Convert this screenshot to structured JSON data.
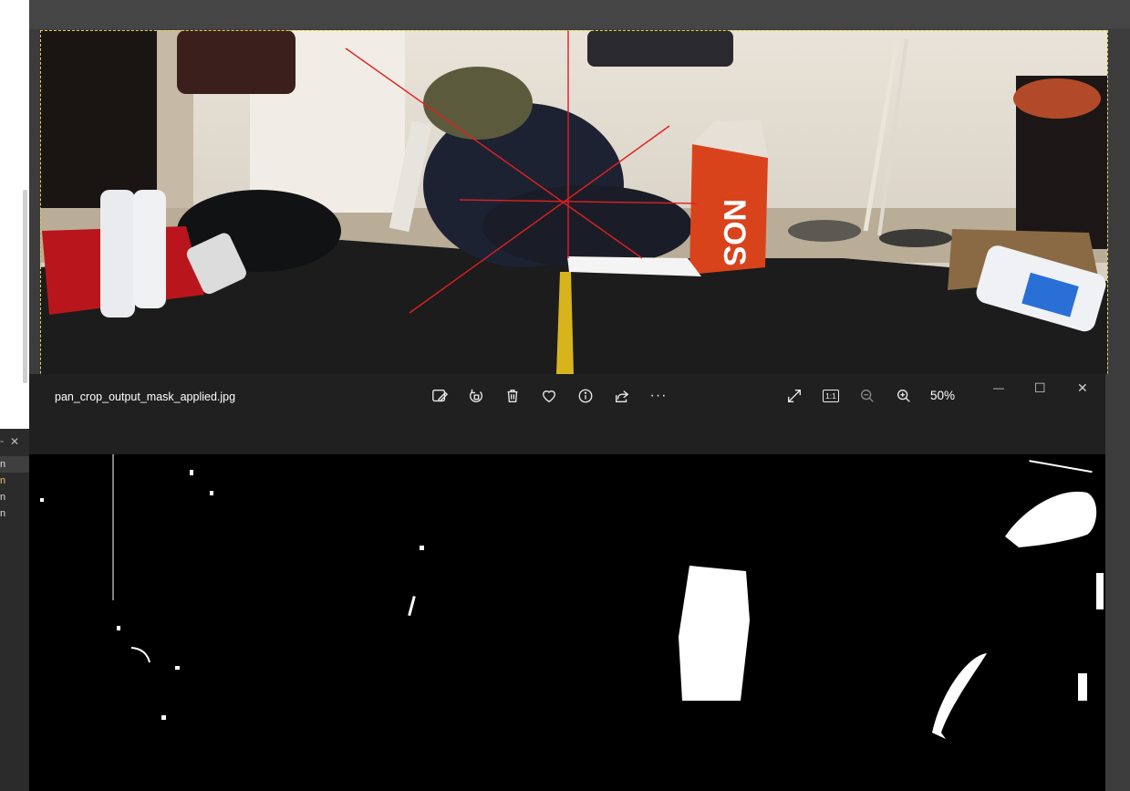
{
  "viewer": {
    "filename": "pan_crop_output_mask_applied.jpg",
    "zoom": "50%",
    "toolbar": {
      "edit_icon": "edit-image-icon",
      "rotate_icon": "rotate-icon",
      "delete_icon": "trash-icon",
      "favorite_icon": "heart-icon",
      "info_icon": "info-icon",
      "share_icon": "share-icon",
      "more_label": "···",
      "fullscreen_icon": "expand-icon",
      "actual_size_label": "1:1",
      "zoom_out_icon": "zoom-out-icon",
      "zoom_in_icon": "zoom-in-icon"
    },
    "window": {
      "minimize": "—",
      "maximize": "☐",
      "close": "✕"
    }
  },
  "side_panel": {
    "tab_close": "✕",
    "rows": [
      "n",
      "n",
      "n",
      "n"
    ]
  },
  "colors": {
    "selection_marching_ants": "#e6d24a",
    "viewer_bar": "#202020",
    "crosshair": "#e02020"
  }
}
